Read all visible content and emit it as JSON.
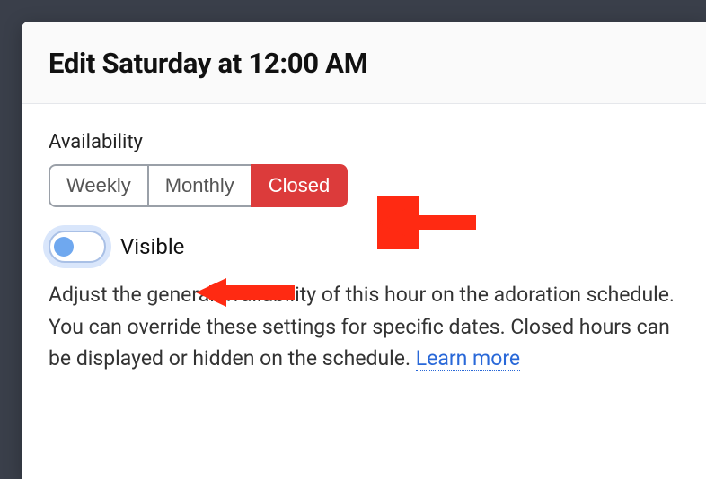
{
  "modal": {
    "title": "Edit Saturday at 12:00 AM"
  },
  "availability": {
    "label": "Availability",
    "options": {
      "weekly": "Weekly",
      "monthly": "Monthly",
      "closed": "Closed"
    },
    "selected": "closed"
  },
  "visible_toggle": {
    "label": "Visible",
    "value": false
  },
  "help": {
    "text": "Adjust the general availability of this hour on the adoration schedule. You can override these settings for specific dates. Closed hours can be displayed or hidden on the schedule. ",
    "link_label": "Learn more"
  },
  "annotation_color": "#ff2a12"
}
